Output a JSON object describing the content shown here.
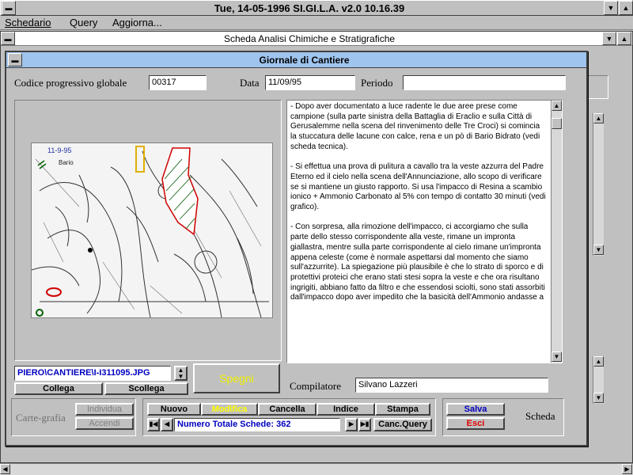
{
  "app": {
    "title": "Tue, 14-05-1996    SI.GI.L.A.  v2.0    10.16.39",
    "min_glyph": "▼",
    "max_glyph": "▲"
  },
  "menu": [
    "Schedario",
    "Query",
    "Aggiorna..."
  ],
  "outer_window": {
    "title": "Scheda Analisi Chimiche e Stratigrafiche"
  },
  "dialog": {
    "title": "Giornale di Cantiere",
    "codice_label": "Codice progressivo globale",
    "codice_value": "00317",
    "data_label": "Data",
    "data_value": "11/09/95",
    "periodo_label": "Periodo",
    "periodo_value": "",
    "journal_text": "- Dopo aver documentato a luce radente le due aree prese come campione (sulla parte sinistra della Battaglia di Eraclio e sulla Città di Gerusalemme nella scena del rinvenimento delle Tre Croci) si comincia la stuccatura delle lacune con calce, rena e un pò di Bario Bidrato (vedi scheda tecnica).\n\n- Si effettua una prova di pulitura a cavallo tra la veste azzurra del Padre Eterno ed il cielo nella scena dell'Annunciazione, allo scopo di verificare se si mantiene un giusto rapporto. Si usa l'impacco di Resina a scambio ionico + Ammonio Carbonato al 5% con tempo di contatto 30 minuti (vedi grafico).\n\n- Con sorpresa, alla rimozione dell'impacco, ci accorgiamo che sulla parte dello stesso corrispondente alla veste, rimane un impronta giallastra, mentre sulla parte corrispondente al cielo rimane un'impronta appena celeste (come è normale aspettarsi dal momento che siamo sull'azzurrite). La spiegazione più plausibile è che lo strato di sporco e di protettivi proteici che erano stati stesi sopra la veste e che ora risultano ingrigiti, abbiano fatto da filtro e che essendosi sciolti, sono stati assorbiti dall'impacco dopo aver impedito che la basicità dell'Ammonio andasse a",
    "image_path": "PIERO\\CANTIERE\\I-I311095.JPG",
    "image_caption": "11-9-95",
    "image_legend": "Bario",
    "collega_label": "Collega",
    "scollega_label": "Scollega",
    "spegni_label": "Spegni",
    "compilatore_label": "Compilatore",
    "compilatore_value": "Silvano Lazzeri",
    "carte_label": "Carte-grafia",
    "individua_label": "Individua",
    "accendi_label": "Accendi",
    "buttons": {
      "nuovo": "Nuovo",
      "modifica": "Modifica",
      "cancella": "Cancella",
      "indice": "Indice",
      "stampa": "Stampa",
      "salva": "Salva",
      "esci": "Esci",
      "canc_query": "Canc.Query"
    },
    "scheda_label": "Scheda",
    "record_count_label": "Numero Totale Schede: 362"
  },
  "colors": {
    "title_blue": "#1a2a8c",
    "modifica_yellow": "#ffff00",
    "spegni_yellow": "#f0f000",
    "salva_blue": "#0000c0",
    "esci_red": "#e00000"
  }
}
